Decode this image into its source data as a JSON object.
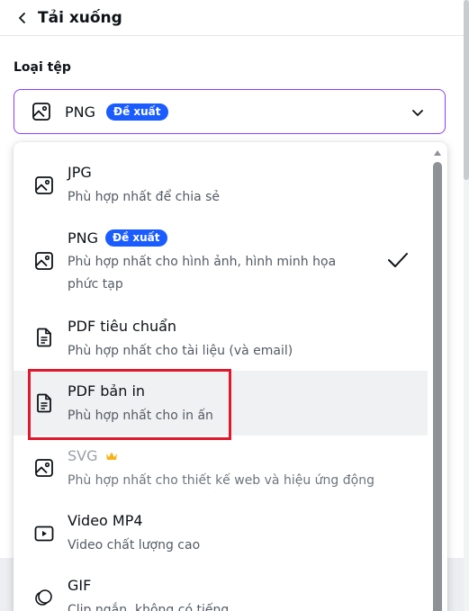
{
  "header": {
    "title": "Tải xuống"
  },
  "file_type": {
    "label": "Loại tệp",
    "selected": "PNG",
    "selected_badge": "Đề xuất"
  },
  "options": [
    {
      "title": "JPG",
      "desc": "Phù hợp nhất để chia sẻ",
      "icon": "image-icon"
    },
    {
      "title": "PNG",
      "badge": "Đề xuất",
      "desc1": "Phù hợp nhất cho hình ảnh, hình minh họa",
      "desc2": "phức tạp",
      "icon": "image-icon",
      "selected": true
    },
    {
      "title": "PDF tiêu chuẩn",
      "desc": "Phù hợp nhất cho tài liệu (và email)",
      "icon": "document-icon"
    },
    {
      "title": "PDF bản in",
      "desc": "Phù hợp nhất cho in ấn",
      "icon": "document-icon",
      "highlighted": true
    },
    {
      "title": "SVG",
      "desc": "Phù hợp nhất cho thiết kế web và hiệu ứng động",
      "icon": "image-icon",
      "premium": true
    },
    {
      "title": "Video MP4",
      "desc": "Video chất lượng cao",
      "icon": "video-icon"
    },
    {
      "title": "GIF",
      "desc": "Clip ngắn, không có tiếng",
      "icon": "gif-icon"
    }
  ],
  "colors": {
    "accent": "#8b3dff",
    "badge": "#1a5cff",
    "highlight": "#e0182d",
    "crown": "#f5b31a"
  }
}
